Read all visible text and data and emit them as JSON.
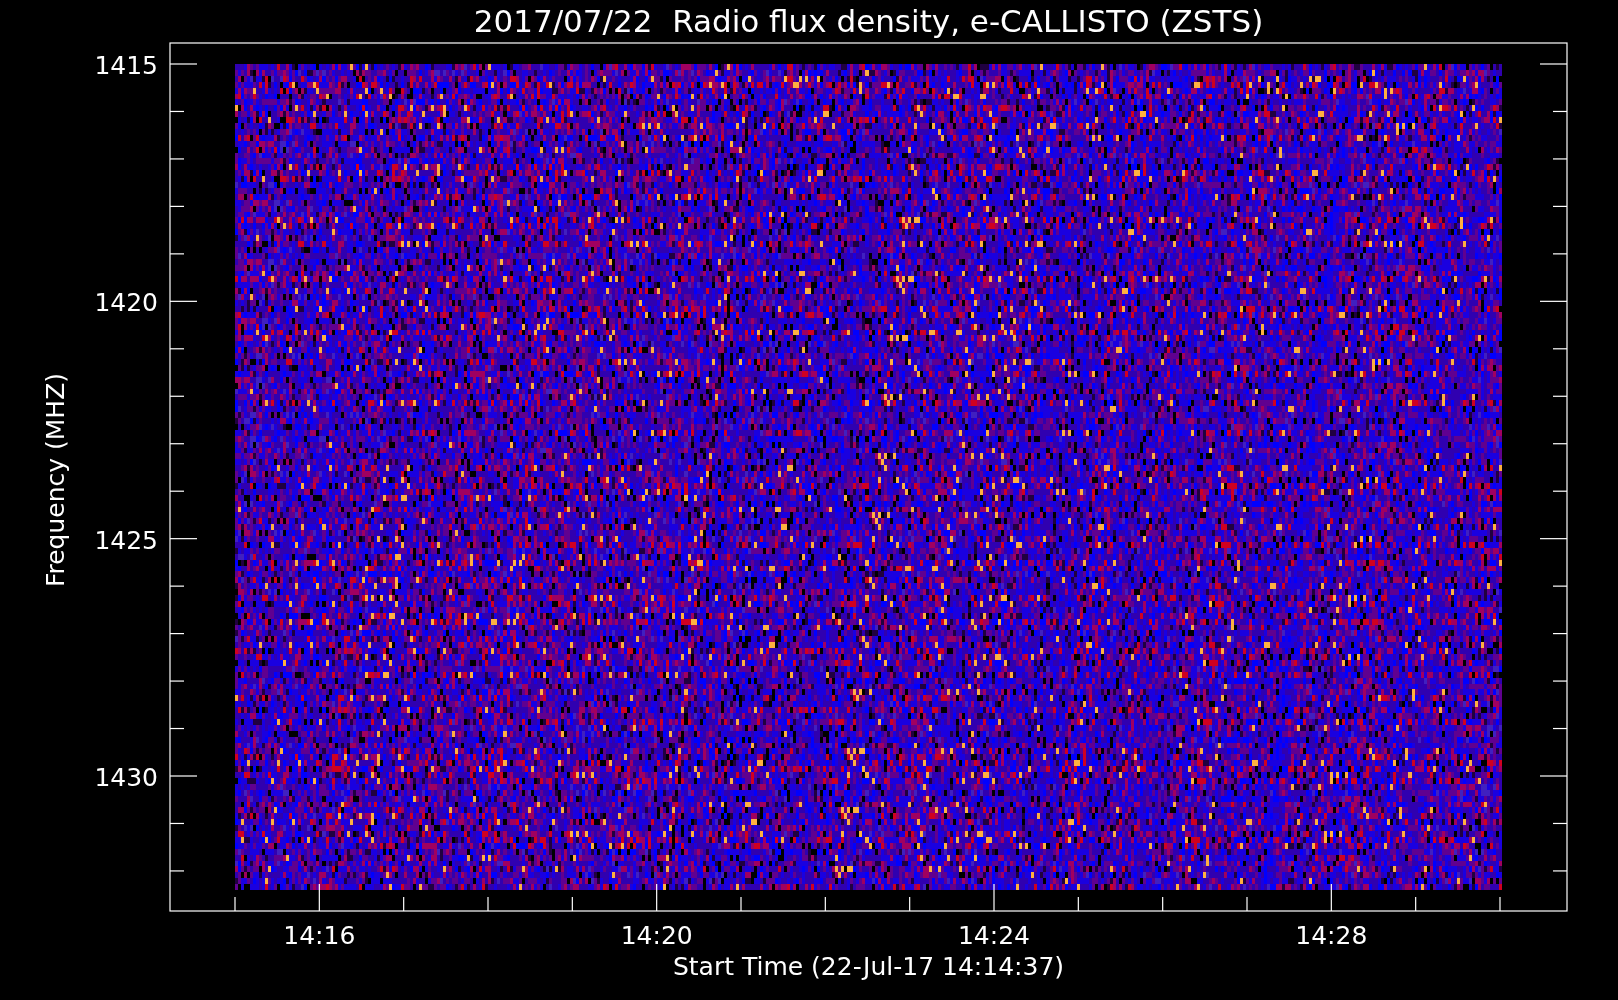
{
  "plot": {
    "title": "2017/07/22  Radio flux density, e-CALLISTO (ZSTS)",
    "y_axis": {
      "label": "Frequency (MHZ)",
      "tick_labels": [
        "1415",
        "1420",
        "1425",
        "1430"
      ]
    },
    "x_axis": {
      "label": "Start Time (22-Jul-17 14:14:37)",
      "tick_labels": [
        "14:16",
        "14:20",
        "14:24",
        "14:28"
      ]
    }
  }
}
